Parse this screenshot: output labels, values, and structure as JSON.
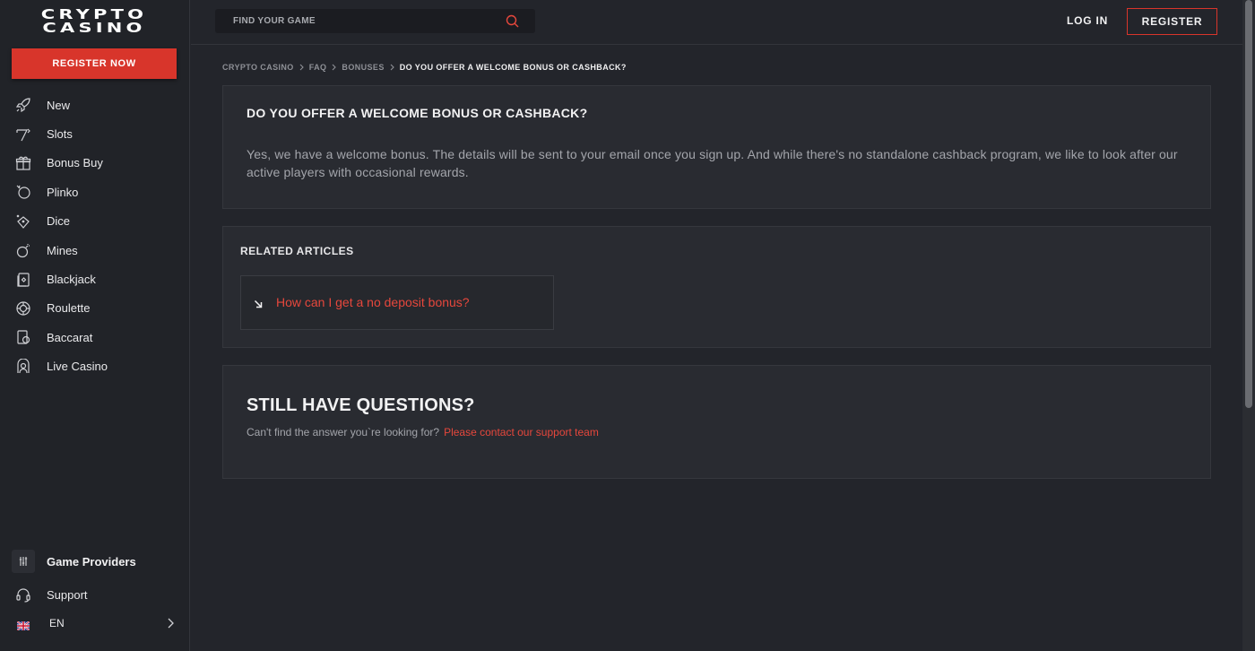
{
  "brand": {
    "logo_line1": "CRYPTO",
    "logo_line2": "CASINO"
  },
  "sidebar": {
    "register_now": "REGISTER NOW",
    "items": [
      {
        "label": "New",
        "icon": "rocket-icon"
      },
      {
        "label": "Slots",
        "icon": "slot-machine-icon"
      },
      {
        "label": "Bonus Buy",
        "icon": "gift-icon"
      },
      {
        "label": "Plinko",
        "icon": "plinko-icon"
      },
      {
        "label": "Dice",
        "icon": "dice-icon"
      },
      {
        "label": "Mines",
        "icon": "bomb-icon"
      },
      {
        "label": "Blackjack",
        "icon": "cards-icon"
      },
      {
        "label": "Roulette",
        "icon": "roulette-icon"
      },
      {
        "label": "Baccarat",
        "icon": "baccarat-icon"
      },
      {
        "label": "Live Casino",
        "icon": "live-dealer-icon"
      }
    ],
    "game_providers": "Game Providers",
    "support": "Support",
    "language": "EN"
  },
  "topbar": {
    "search_placeholder": "FIND YOUR GAME",
    "login": "LOG IN",
    "register": "REGISTER"
  },
  "breadcrumb": [
    "CRYPTO CASINO",
    "FAQ",
    "BONUSES",
    "DO YOU OFFER A WELCOME BONUS OR CASHBACK?"
  ],
  "faq": {
    "question": "DO YOU OFFER A WELCOME BONUS OR CASHBACK?",
    "answer": "Yes, we have a welcome bonus. The details will be sent to your email once you sign up. And while there's no standalone cashback program, we like to look after our active players with occasional rewards."
  },
  "related": {
    "title": "RELATED ARTICLES",
    "articles": [
      "How can I get a no deposit bonus?"
    ]
  },
  "still": {
    "title": "STILL HAVE QUESTIONS?",
    "text": "Can't find the answer you`re looking for?",
    "link": "Please contact our support team"
  },
  "colors": {
    "accent": "#d8352b",
    "link": "#e6473c",
    "background": "#23252b",
    "panel": "#292b31"
  }
}
